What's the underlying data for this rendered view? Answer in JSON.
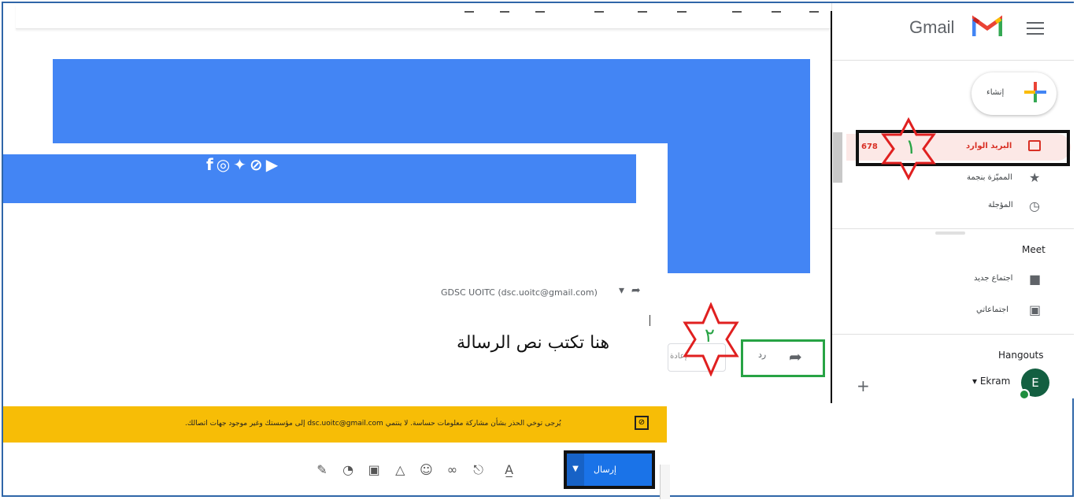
{
  "sidebar": {
    "app_name": "Gmail",
    "compose_label": "إنشاء",
    "inbox_label": "البريد الوارد",
    "inbox_count": "678",
    "starred_label": "المميّزة بنجمة",
    "snoozed_label": "المؤجلة",
    "meet_title": "Meet",
    "new_meeting_label": "اجتماع جديد",
    "my_meetings_label": "اجتماعاتي",
    "hangouts_title": "Hangouts",
    "user_name": "Ekram",
    "user_initial": "E",
    "add_label": "+"
  },
  "message": {
    "sender": "GDSC UOITC (dsc.uoitc@gmail.com)",
    "body_text": "هنا تكتب نص الرسالة",
    "reply_label": "رد",
    "forward_label": "إعادة",
    "warning_text": "يُرجى توخي الحذر بشأن مشاركة معلومات حساسة. لا ينتمي dsc.uoitc@gmail.com إلى مؤسستك وغير موجود جهات اتصالك.",
    "send_label": "إرسال"
  },
  "annotations": {
    "star1_number": "١",
    "star2_number": "٢"
  },
  "icons": {
    "social": [
      "facebook-icon",
      "instagram-icon",
      "twitter-icon",
      "telegram-icon",
      "youtube-icon"
    ],
    "toolbar": [
      "format-text-icon",
      "attach-icon",
      "link-icon",
      "emoji-icon",
      "drive-icon",
      "image-icon",
      "confidential-icon",
      "signature-icon"
    ]
  },
  "colors": {
    "accent_blue": "#4385f4",
    "warning_yellow": "#f7bd06",
    "inbox_red": "#d93025",
    "highlight_green": "#27a344",
    "star_red": "#e02020"
  }
}
